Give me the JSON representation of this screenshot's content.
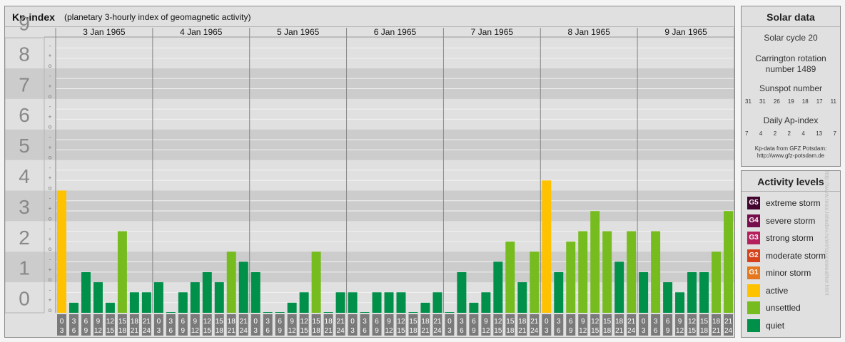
{
  "header": {
    "title": "Kp-index",
    "subtitle": "(planetary 3-hourly index of geomagnetic activity)"
  },
  "colors": {
    "quiet": "#00904a",
    "unsettled": "#77bc1f",
    "active": "#fec200",
    "minor": "#e5771e",
    "moderate": "#d6421b",
    "strong": "#b3205c",
    "severe": "#750e4a",
    "extreme": "#420530"
  },
  "chart_data": {
    "type": "bar",
    "title": "Kp-index",
    "ylim": [
      0,
      9
    ],
    "y_ticks": [
      "0",
      "1",
      "2",
      "3",
      "4",
      "5",
      "6",
      "7",
      "8",
      "9"
    ],
    "sub_ticks": [
      "o",
      "+",
      "-"
    ],
    "days": [
      "3 Jan 1965",
      "4 Jan 1965",
      "5 Jan 1965",
      "6 Jan 1965",
      "7 Jan 1965",
      "8 Jan 1965",
      "9 Jan 1965"
    ],
    "hour_labels": [
      [
        "0",
        "3"
      ],
      [
        "3",
        "6"
      ],
      [
        "6",
        "9"
      ],
      [
        "9",
        "12"
      ],
      [
        "12",
        "15"
      ],
      [
        "15",
        "18"
      ],
      [
        "18",
        "21"
      ],
      [
        "21",
        "24"
      ]
    ],
    "values": [
      4.0,
      0.33,
      1.33,
      1.0,
      0.33,
      2.67,
      0.67,
      0.67,
      1.0,
      0.0,
      0.67,
      1.0,
      1.33,
      1.0,
      2.0,
      1.67,
      1.33,
      0.0,
      0.0,
      0.33,
      0.67,
      2.0,
      0.0,
      0.67,
      0.67,
      0.0,
      0.67,
      0.67,
      0.67,
      0.0,
      0.33,
      0.67,
      0.0,
      1.33,
      0.33,
      0.67,
      1.67,
      2.33,
      1.0,
      2.0,
      4.33,
      1.33,
      2.33,
      2.67,
      3.33,
      2.67,
      1.67,
      2.67,
      1.33,
      2.67,
      1.0,
      0.67,
      1.33,
      1.33,
      2.0,
      3.33
    ],
    "grid": true
  },
  "solar": {
    "title": "Solar data",
    "cycle": "Solar cycle 20",
    "carrington_line1": "Carrington rotation",
    "carrington_line2": "number 1489",
    "sunspot_title": "Sunspot number",
    "sunspots": [
      "31",
      "31",
      "26",
      "19",
      "18",
      "17",
      "11"
    ],
    "ap_title": "Daily Ap-index",
    "ap": [
      "7",
      "4",
      "2",
      "2",
      "4",
      "13",
      "7"
    ],
    "source_line1": "Kp-data from GFZ Potsdam:",
    "source_line2": "http://www.gfz-potsdam.de"
  },
  "activity": {
    "title": "Activity levels",
    "items": [
      {
        "code": "G5",
        "label": "extreme storm",
        "color": "#420530"
      },
      {
        "code": "G4",
        "label": "severe storm",
        "color": "#750e4a"
      },
      {
        "code": "G3",
        "label": "strong storm",
        "color": "#b3205c"
      },
      {
        "code": "G2",
        "label": "moderate storm",
        "color": "#d6421b"
      },
      {
        "code": "G1",
        "label": "minor storm",
        "color": "#e5771e"
      },
      {
        "code": "",
        "label": "active",
        "color": "#fec200"
      },
      {
        "code": "",
        "label": "unsettled",
        "color": "#77bc1f"
      },
      {
        "code": "",
        "label": "quiet",
        "color": "#00904a"
      }
    ]
  },
  "credit": "http://www.tesis.lebedev.ru/en/spaceweather.html"
}
